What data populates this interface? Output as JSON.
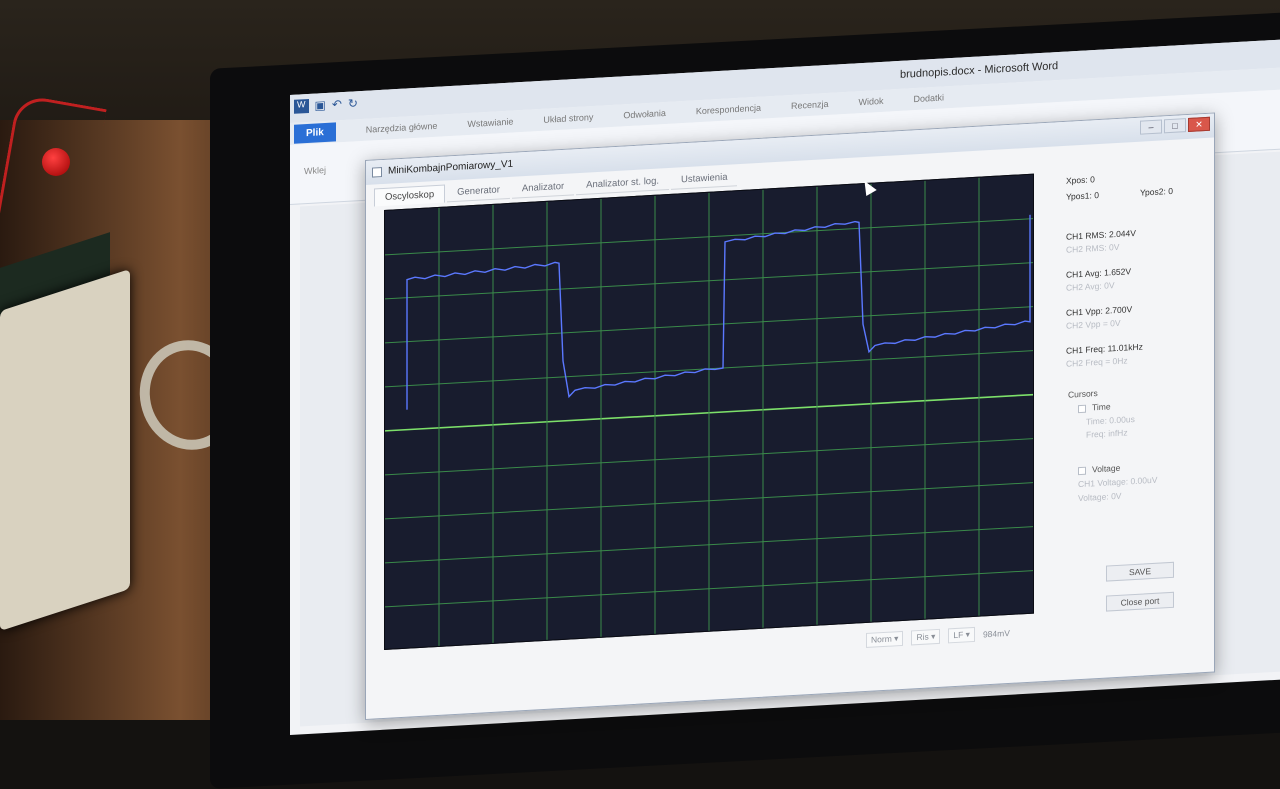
{
  "word": {
    "title": "brudnopis.docx - Microsoft Word",
    "tabs": [
      "Plik",
      "Narzędzia główne",
      "Wstawianie",
      "Układ strony",
      "Odwołania",
      "Korespondencja",
      "Recenzja",
      "Widok",
      "Dodatki"
    ],
    "ribbon_left": "Wklej"
  },
  "app": {
    "title": "MiniKombajnPomiarowy_V1",
    "tabs": [
      "Oscyloskop",
      "Generator",
      "Analizator",
      "Analizator st. log.",
      "Ustawienia"
    ],
    "active_tab": "Oscyloskop"
  },
  "side": {
    "xpos": "Xpos: 0",
    "ypos1": "Ypos1: 0",
    "ypos2": "Ypos2: 0",
    "ch1_rms": "CH1 RMS: 2.044V",
    "ch2_rms": "CH2 RMS: 0V",
    "ch1_avg": "CH1 Avg: 1.652V",
    "ch2_avg": "CH2 Avg: 0V",
    "ch1_vpp": "CH1 Vpp: 2.700V",
    "ch2_vpp": "CH2 Vpp = 0V",
    "ch1_freq": "CH1 Freq: 11.01kHz",
    "ch2_freq": "CH2 Freq = 0Hz",
    "cursors_label": "Cursors",
    "time_label": "Time",
    "time_value": "Time: 0.00us",
    "freq_value": "Freq: infHz",
    "voltage_label": "Voltage",
    "ch1_voltage": "CH1 Voltage: 0.00uV",
    "voltage_value": "Voltage: 0V",
    "save_label": "SAVE",
    "close_port_label": "Close port"
  },
  "bottom": {
    "mode": "Norm",
    "edge": "Ris",
    "coupling": "LF",
    "level": "984mV"
  }
}
